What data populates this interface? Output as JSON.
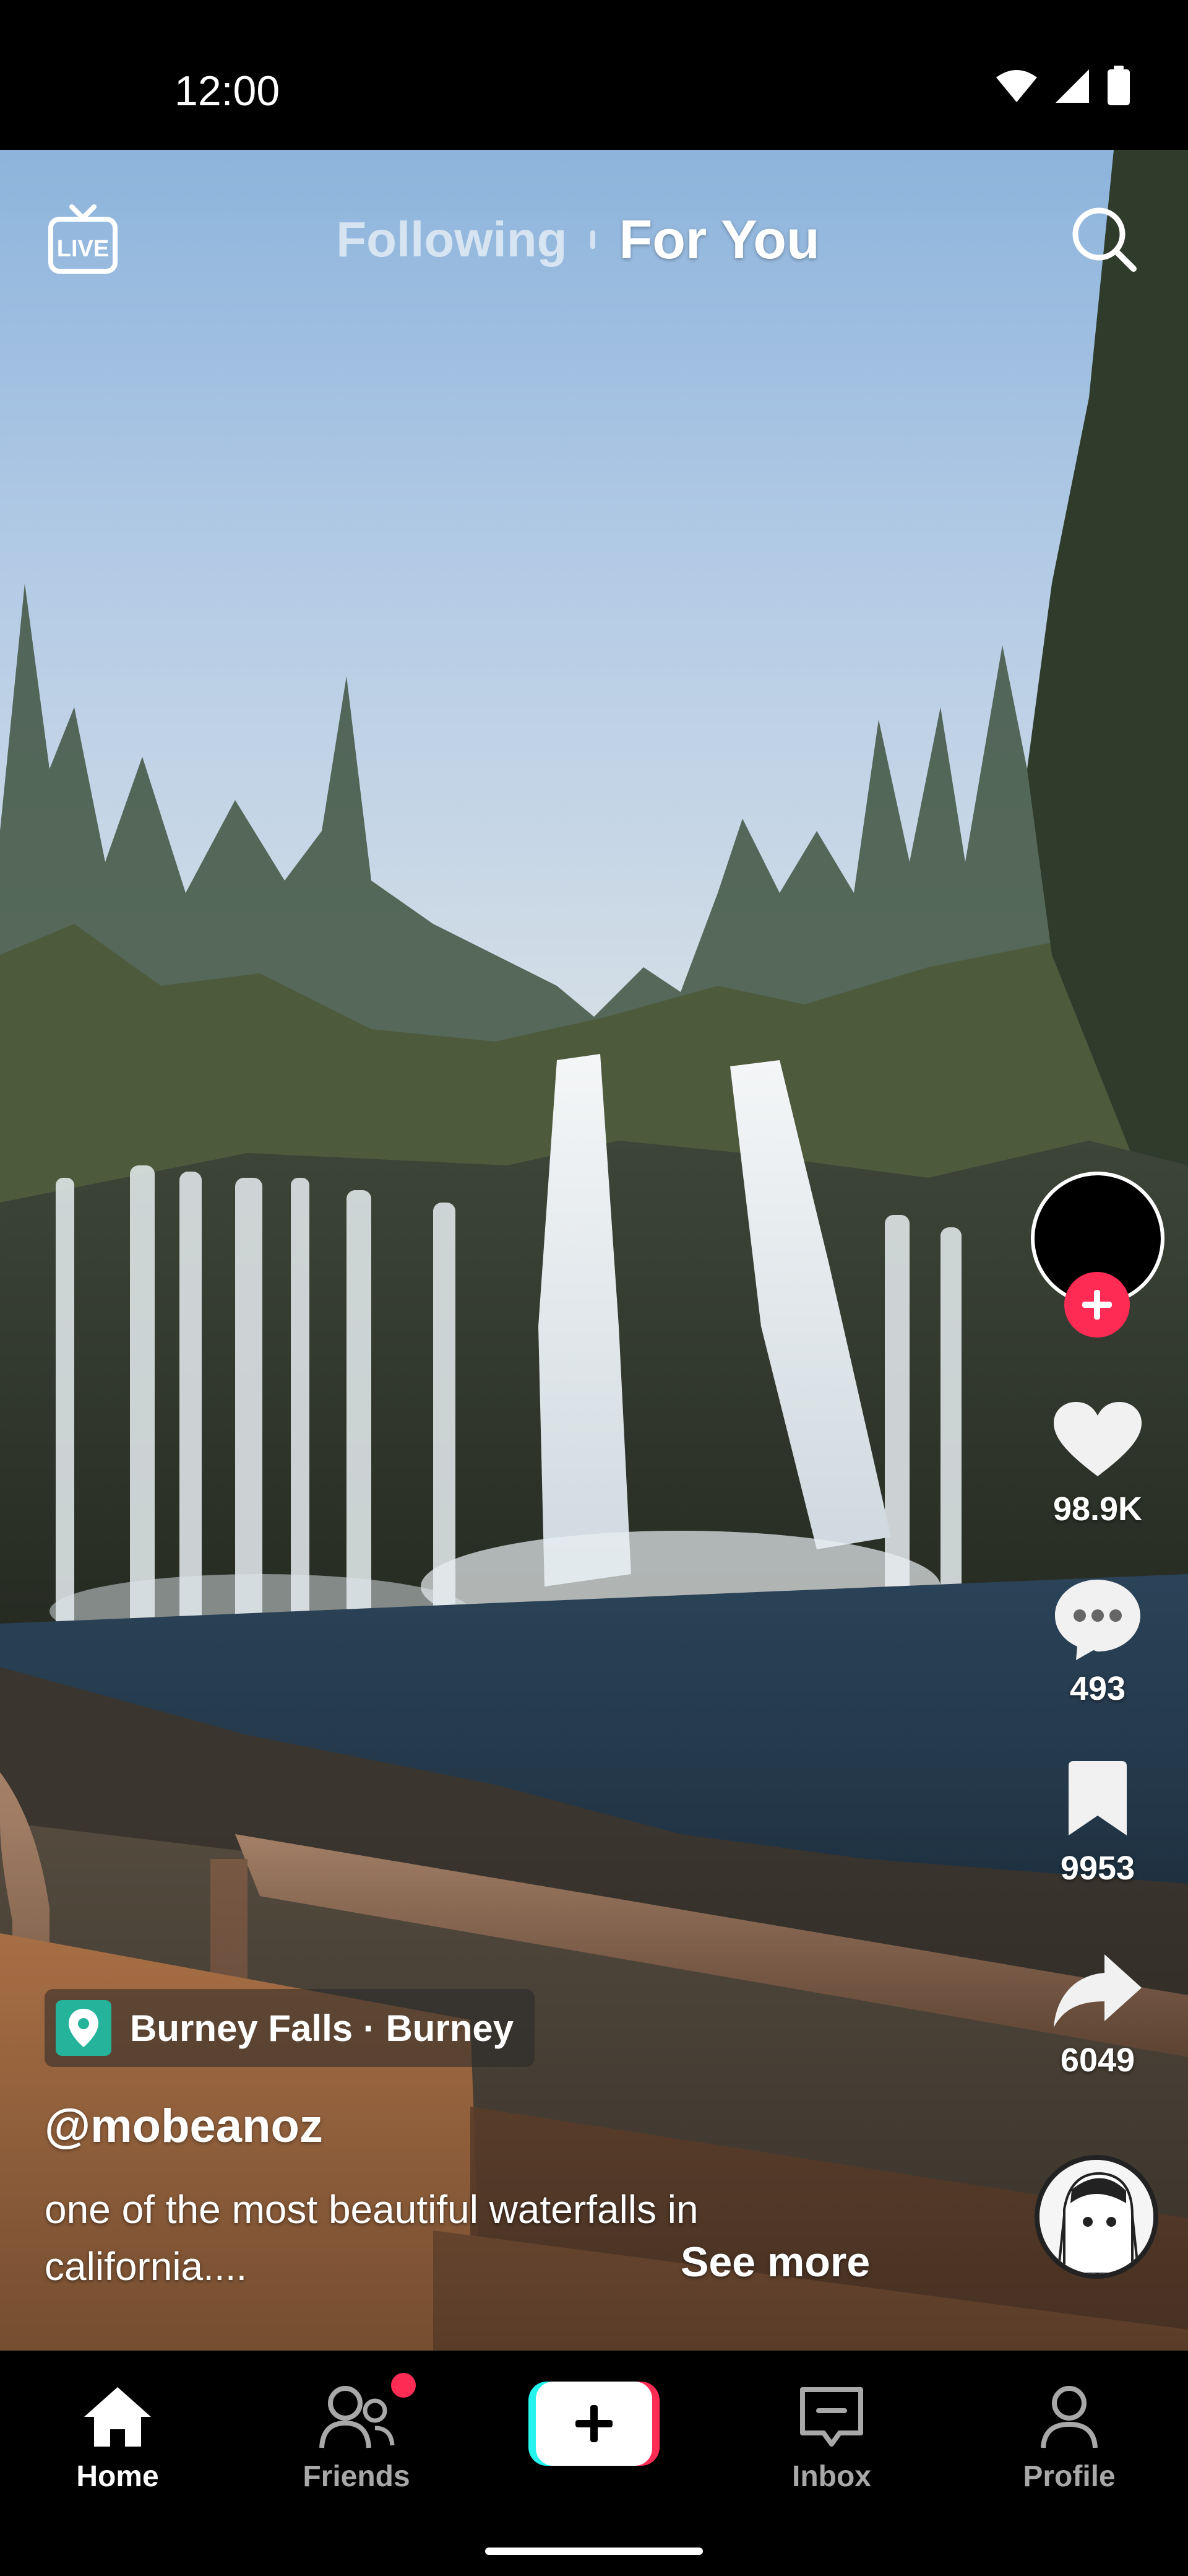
{
  "status_bar": {
    "time": "12:00",
    "icons": [
      "wifi-icon",
      "cellular-signal-icon",
      "battery-icon"
    ]
  },
  "top_nav": {
    "live_label": "LIVE",
    "tabs": [
      {
        "label": "Following",
        "active": false
      },
      {
        "label": "For You",
        "active": true
      }
    ],
    "search_icon": "search-icon"
  },
  "video": {
    "description": "waterfall-scene"
  },
  "actions": {
    "likes": "98.9K",
    "comments": "493",
    "bookmarks": "9953",
    "shares": "6049"
  },
  "post": {
    "location": "Burney Falls · Burney",
    "username": "@mobeanoz",
    "caption_line1": "one of the most beautiful waterfalls in",
    "caption_line2": "california....",
    "see_more": "See more"
  },
  "bottom_nav": {
    "items": [
      {
        "label": "Home",
        "active": true
      },
      {
        "label": "Friends",
        "active": false,
        "has_notification": true
      },
      {
        "label": "",
        "active": false
      },
      {
        "label": "Inbox",
        "active": false
      },
      {
        "label": "Profile",
        "active": false
      }
    ]
  },
  "colors": {
    "accent": "#fe2c55",
    "cyan": "#25f4ee",
    "location": "#25b39b"
  }
}
